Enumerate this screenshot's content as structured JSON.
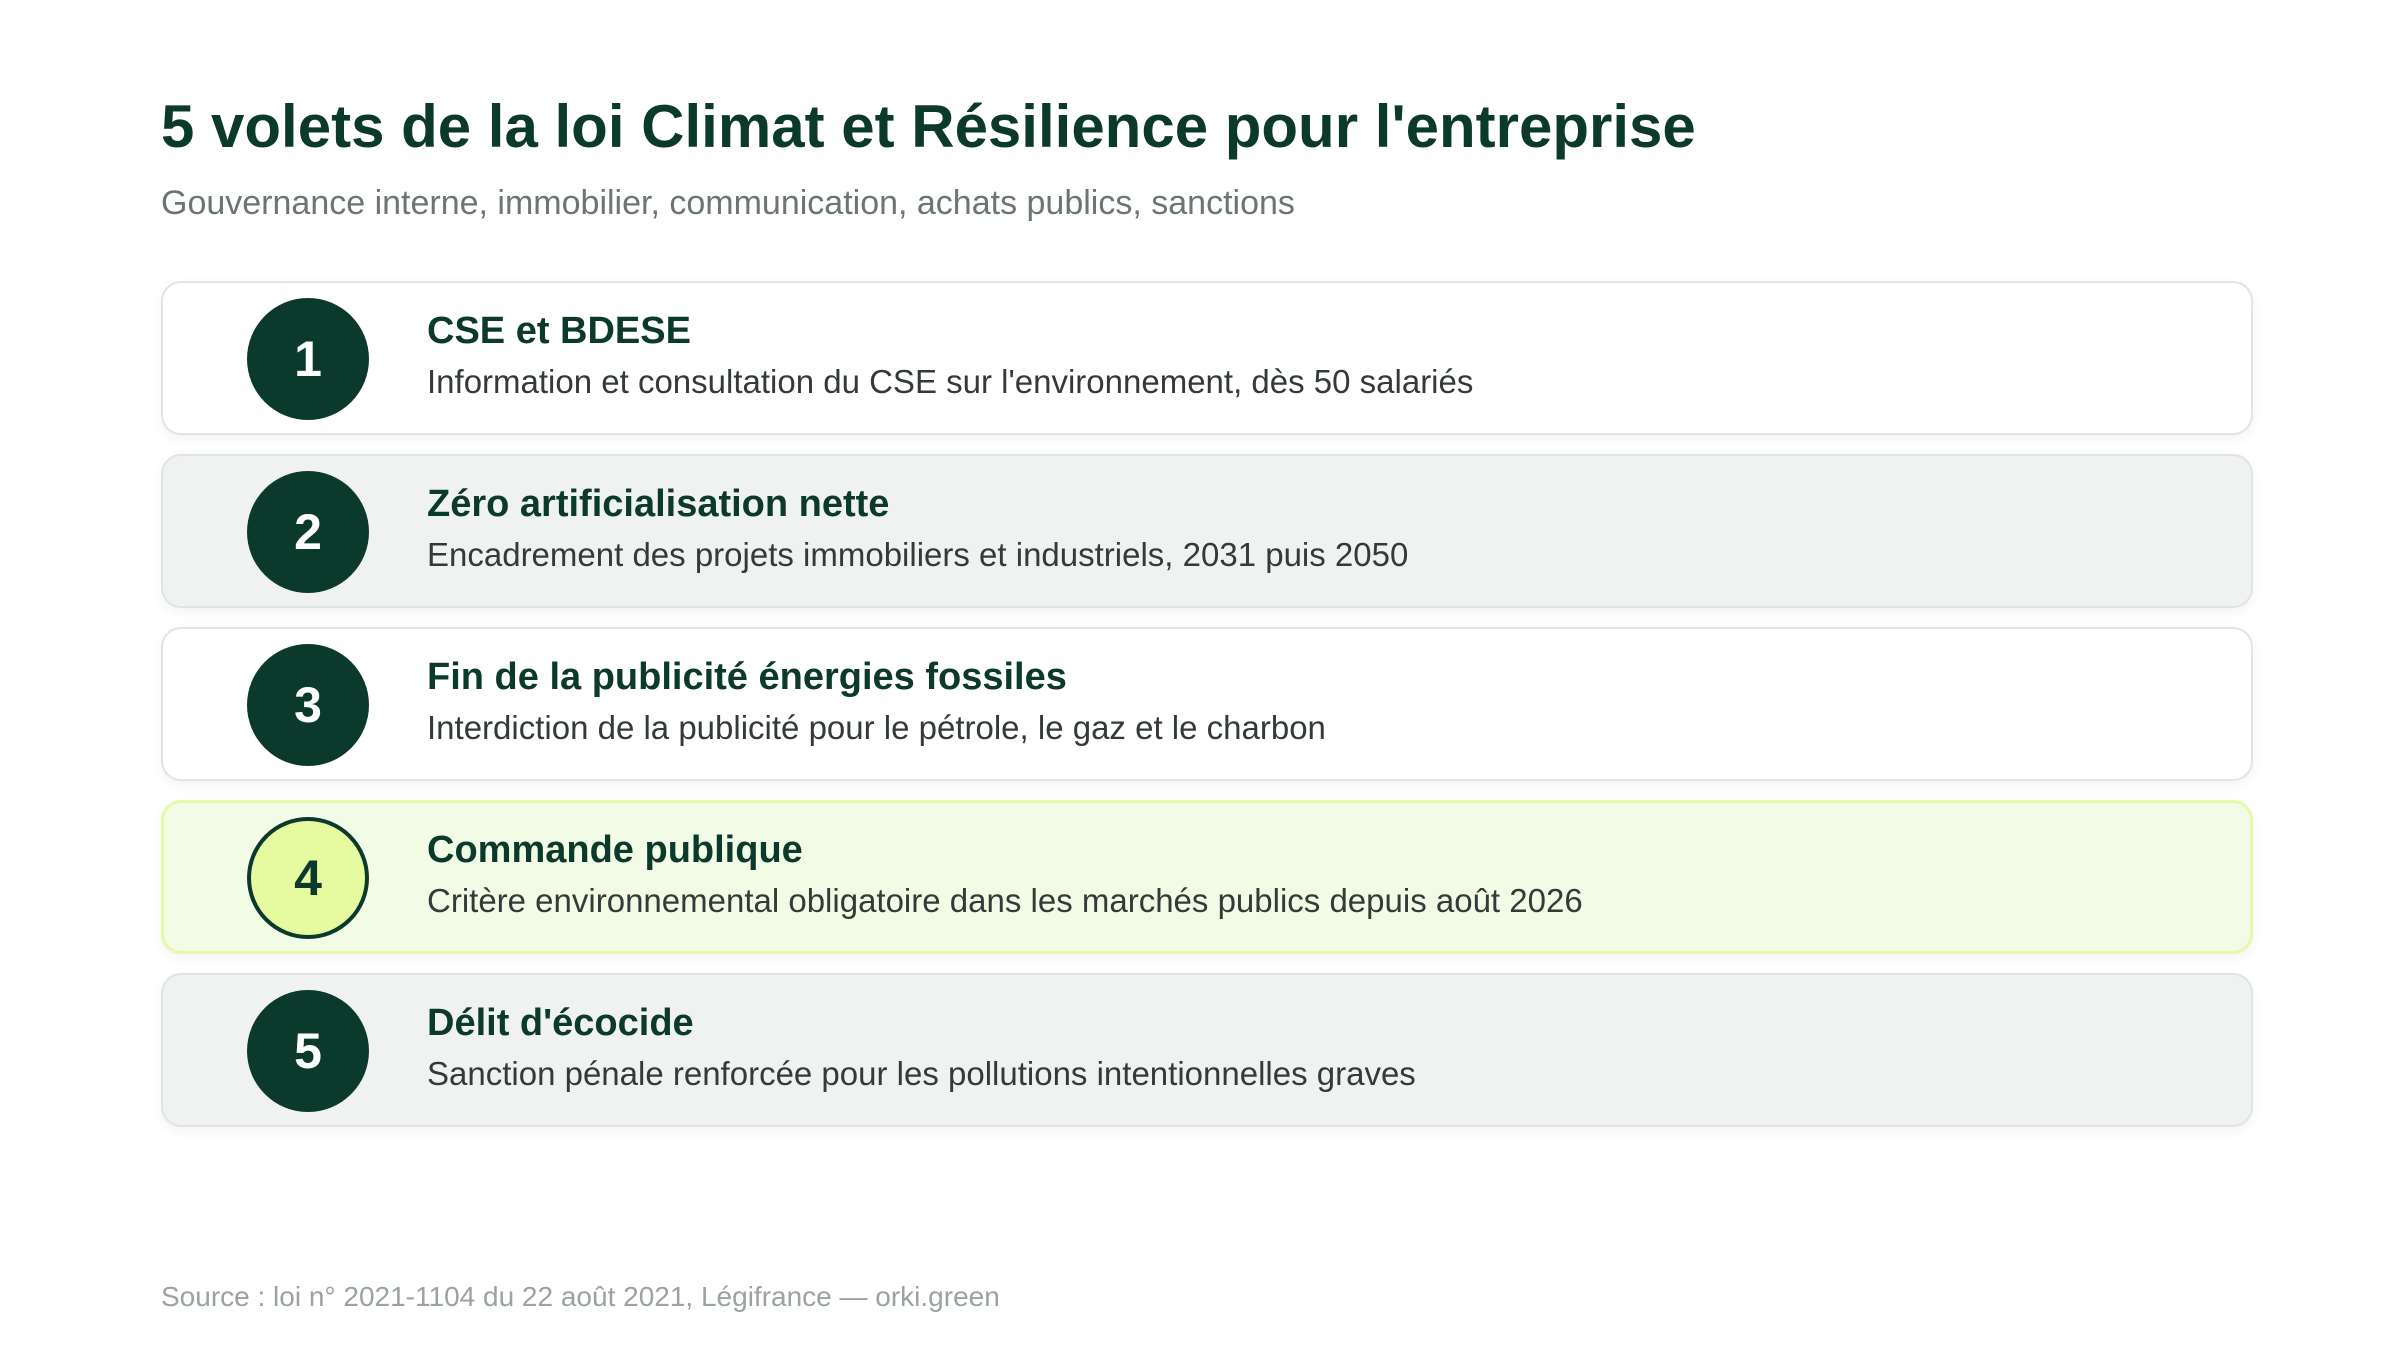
{
  "header": {
    "title": "5 volets de la loi Climat et Résilience pour l'entreprise",
    "subtitle": "Gouvernance interne, immobilier, communication, achats publics, sanctions"
  },
  "items": [
    {
      "number": "1",
      "title": "CSE et BDESE",
      "description": "Information et consultation du CSE sur l'environnement, dès 50 salariés"
    },
    {
      "number": "2",
      "title": "Zéro artificialisation nette",
      "description": "Encadrement des projets immobiliers et industriels, 2031 puis 2050"
    },
    {
      "number": "3",
      "title": "Fin de la publicité énergies fossiles",
      "description": "Interdiction de la publicité pour le pétrole, le gaz et le charbon"
    },
    {
      "number": "4",
      "title": "Commande publique",
      "description": "Critère environnemental obligatoire dans les marchés publics depuis août 2026"
    },
    {
      "number": "5",
      "title": "Délit d'écocide",
      "description": "Sanction pénale renforcée pour les pollutions intentionnelles graves"
    }
  ],
  "footer": {
    "source": "Source : loi n° 2021-1104 du 22 août 2021, Légifrance — orki.green"
  },
  "colors": {
    "primary": "#0b3a2c",
    "highlight_fill": "#e6fb9f",
    "highlight_card": "#f2fbe5",
    "alt_card": "#eff2f1"
  }
}
